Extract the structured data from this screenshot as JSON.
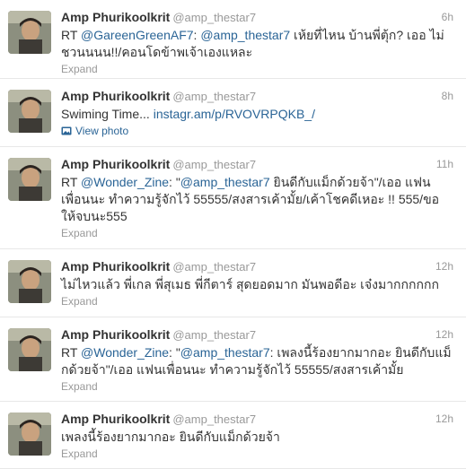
{
  "colors": {
    "link": "#2a6496",
    "muted": "#999999",
    "text": "#333333",
    "divider": "#e8e8e8"
  },
  "tweets": [
    {
      "name": "Amp Phurikoolkrit",
      "handle": "@amp_thestar7",
      "time": "6h",
      "parts": [
        {
          "type": "text",
          "value": "RT "
        },
        {
          "type": "mention",
          "value": "@GareenGreenAF7"
        },
        {
          "type": "text",
          "value": ": "
        },
        {
          "type": "mention",
          "value": "@amp_thestar7"
        },
        {
          "type": "text",
          "value": " เห้ยที่ไหน บ้านพี่ตุ้ก? เออ ไม่ชวนนนน!!/คอนโดข้าพเจ้าเองแหละ"
        }
      ],
      "action": "Expand",
      "action_type": "expand"
    },
    {
      "name": "Amp Phurikoolkrit",
      "handle": "@amp_thestar7",
      "time": "8h",
      "parts": [
        {
          "type": "text",
          "value": "Swiming Time... "
        },
        {
          "type": "link",
          "value": "instagr.am/p/RVOVRPQKB_/"
        }
      ],
      "action": "View photo",
      "action_type": "photo"
    },
    {
      "name": "Amp Phurikoolkrit",
      "handle": "@amp_thestar7",
      "time": "11h",
      "parts": [
        {
          "type": "text",
          "value": "RT "
        },
        {
          "type": "mention",
          "value": "@Wonder_Zine"
        },
        {
          "type": "text",
          "value": ": \""
        },
        {
          "type": "mention",
          "value": "@amp_thestar7"
        },
        {
          "type": "text",
          "value": " ยินดีกับแม็กด้วยจ้า\"/เออ แฟนเพื่อนนะ ทำความรู้จักไว้ 55555/สงสารเค้ามั้ย/เค้าโชคดีเหอะ !! 555/ขอให้จบนะ555"
        }
      ],
      "action": "Expand",
      "action_type": "expand"
    },
    {
      "name": "Amp Phurikoolkrit",
      "handle": "@amp_thestar7",
      "time": "12h",
      "parts": [
        {
          "type": "text",
          "value": "ไม่ไหวแล้ว พี่เกล พี่สุเมธ พี่กีตาร์ สุดยอดมาก มันพอดีอะ เจ๋งมากกกกกก"
        }
      ],
      "action": "Expand",
      "action_type": "expand"
    },
    {
      "name": "Amp Phurikoolkrit",
      "handle": "@amp_thestar7",
      "time": "12h",
      "parts": [
        {
          "type": "text",
          "value": "RT "
        },
        {
          "type": "mention",
          "value": "@Wonder_Zine"
        },
        {
          "type": "text",
          "value": ": \""
        },
        {
          "type": "mention",
          "value": "@amp_thestar7"
        },
        {
          "type": "text",
          "value": ": เพลงนี้ร้องยากมากอะ ยินดีกับแม็กด้วยจ้า\"/เออ แฟนเพื่อนนะ ทำความรู้จักไว้ 55555/สงสารเค้ามั้ย"
        }
      ],
      "action": "Expand",
      "action_type": "expand"
    },
    {
      "name": "Amp Phurikoolkrit",
      "handle": "@amp_thestar7",
      "time": "12h",
      "parts": [
        {
          "type": "text",
          "value": "เพลงนี้ร้องยากมากอะ ยินดีกับแม็กด้วยจ้า"
        }
      ],
      "action": "Expand",
      "action_type": "expand"
    }
  ]
}
